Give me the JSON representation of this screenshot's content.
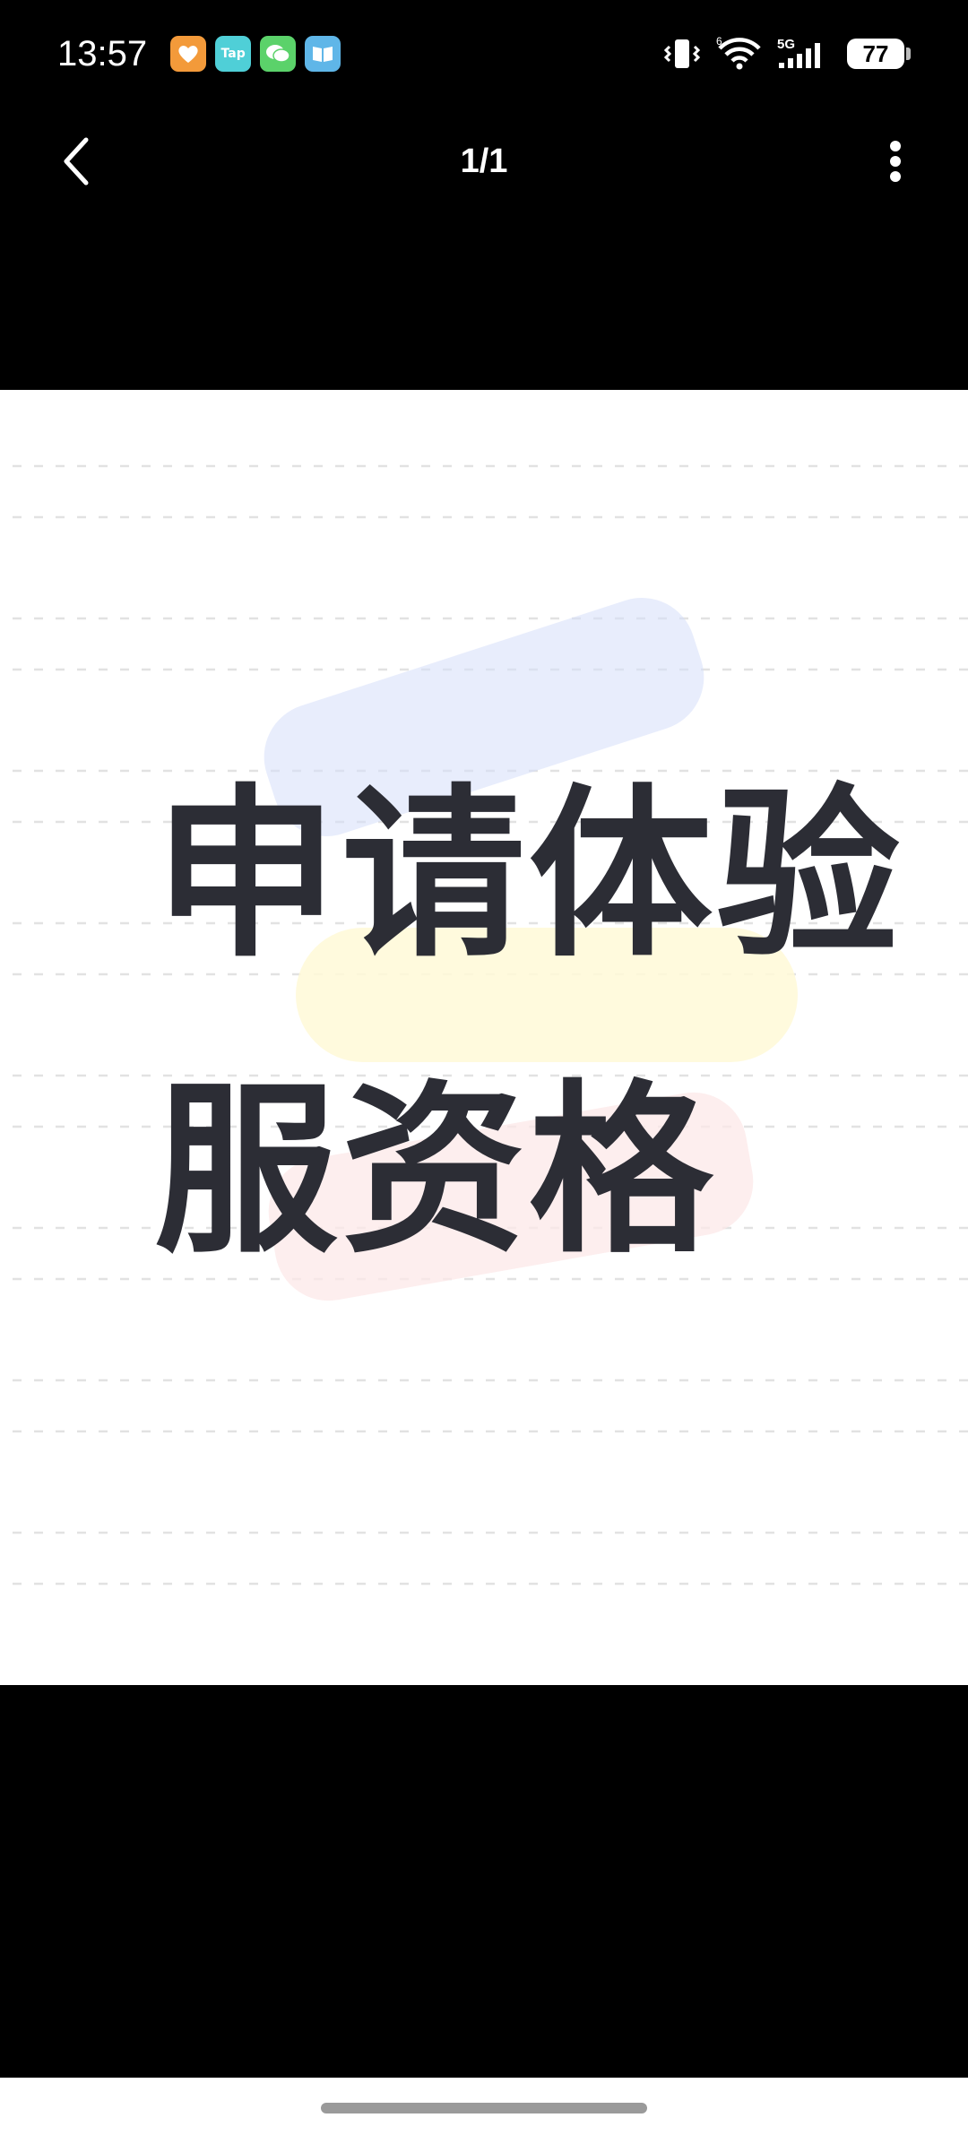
{
  "status_bar": {
    "time": "13:57",
    "app_icons": [
      {
        "name": "heart-app-icon",
        "color": "#f39a3a"
      },
      {
        "name": "tap-app-icon",
        "label": "Tap",
        "color": "#4fcfd7"
      },
      {
        "name": "wechat-icon",
        "color": "#5bd26a"
      },
      {
        "name": "book-app-icon",
        "color": "#5fb6e8"
      }
    ],
    "network_label": "5G",
    "wifi_label": "6",
    "battery_level": "77"
  },
  "header": {
    "page_indicator": "1/1"
  },
  "image": {
    "line1": "申请体验",
    "line2": "服资格",
    "text_color": "#2c2d35"
  }
}
